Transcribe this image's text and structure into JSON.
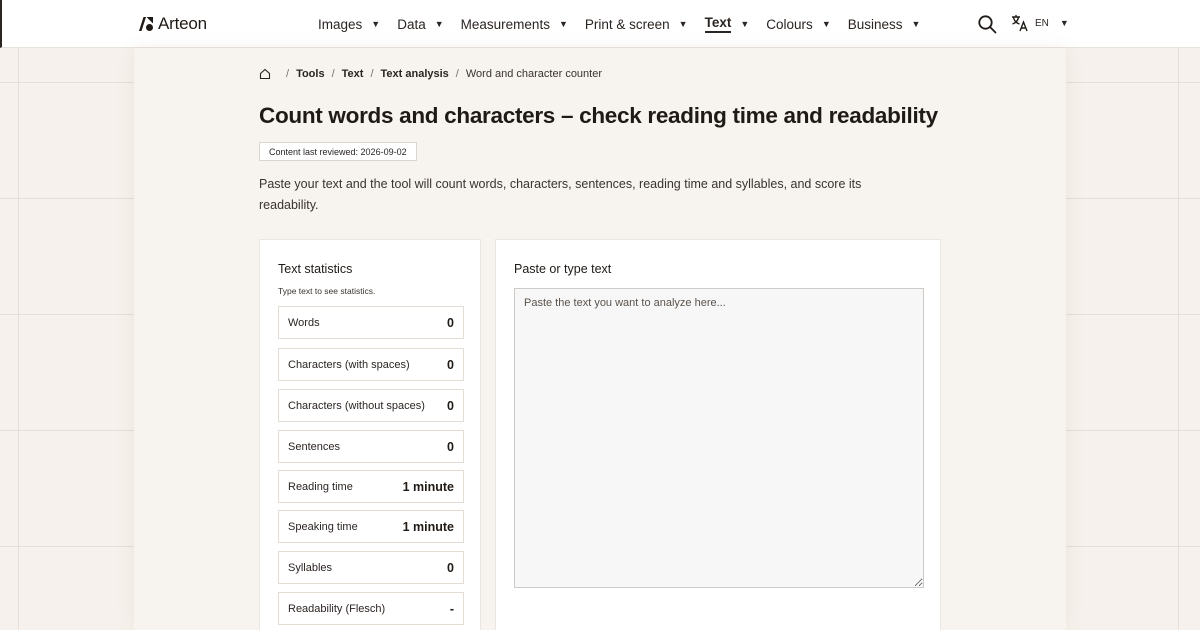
{
  "header": {
    "brand": "Arteon",
    "nav": [
      {
        "label": "Images",
        "active": false
      },
      {
        "label": "Data",
        "active": false
      },
      {
        "label": "Measurements",
        "active": false
      },
      {
        "label": "Print & screen",
        "active": false
      },
      {
        "label": "Text",
        "active": true
      },
      {
        "label": "Colours",
        "active": false
      },
      {
        "label": "Business",
        "active": false
      }
    ],
    "caret": "▼",
    "language": "EN"
  },
  "breadcrumb": {
    "items": [
      "Tools",
      "Text",
      "Text analysis"
    ],
    "separator": "/",
    "current": "Word and character counter"
  },
  "page": {
    "title": "Count words and characters – check reading time and readability",
    "reviewed": "Content last reviewed: 2026-09-02",
    "intro": "Paste your text and the tool will count words, characters, sentences, reading time and syllables, and score its readability."
  },
  "stats": {
    "title": "Text statistics",
    "hint": "Type text to see statistics.",
    "rows": [
      {
        "label": "Words",
        "value": "0"
      },
      {
        "label": "Characters (with spaces)",
        "value": "0"
      },
      {
        "label": "Characters (without spaces)",
        "value": "0"
      },
      {
        "label": "Sentences",
        "value": "0"
      },
      {
        "label": "Reading time",
        "value": "1 minute"
      },
      {
        "label": "Speaking time",
        "value": "1 minute"
      },
      {
        "label": "Syllables",
        "value": "0"
      },
      {
        "label": "Readability (Flesch)",
        "value": "-"
      }
    ]
  },
  "input": {
    "title": "Paste or type text",
    "value": "",
    "placeholder": "Paste the text you want to analyze here..."
  },
  "colors": {
    "background": "#f6f1ec",
    "panel": "#f7f3ef",
    "text": "#1f1a16",
    "border": "#e4ddd6"
  },
  "icons": {
    "logo": "arteon-logo-icon",
    "home": "home-icon",
    "search": "search-icon",
    "language": "translate-icon"
  }
}
